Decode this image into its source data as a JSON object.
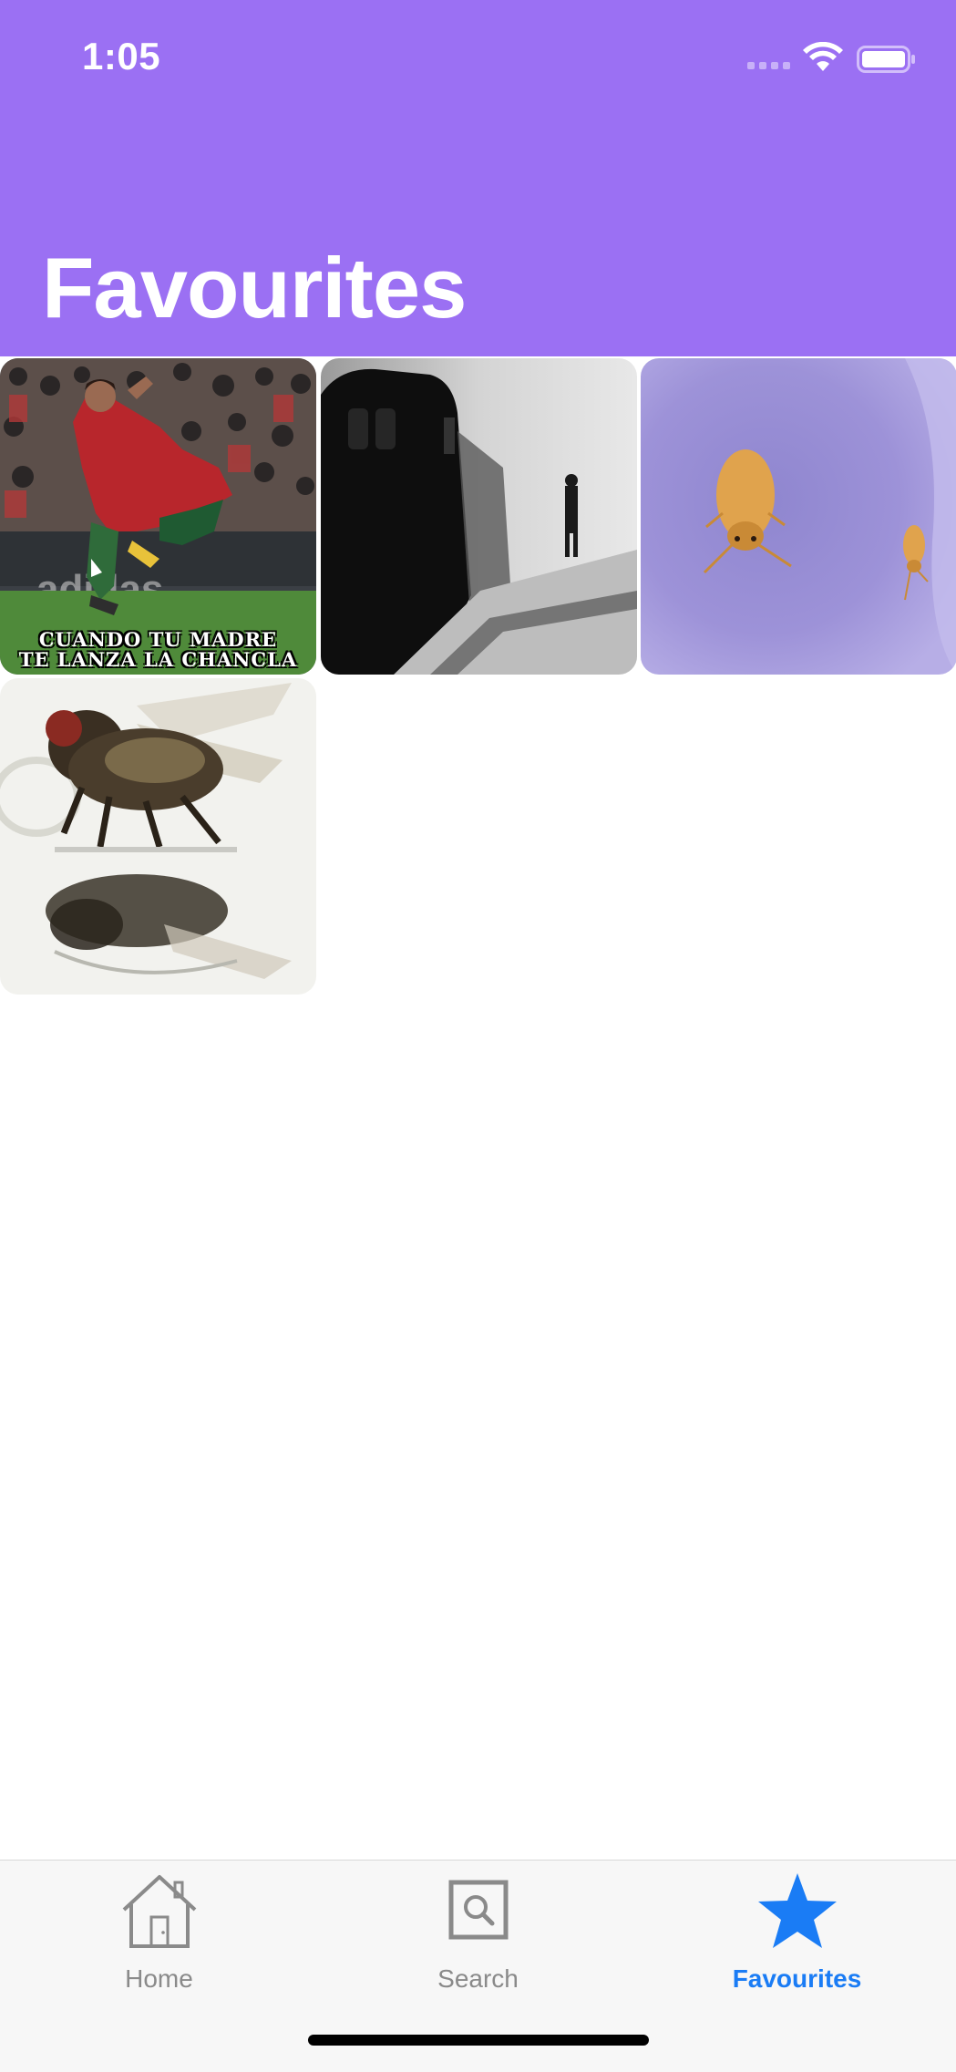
{
  "status_bar": {
    "time": "1:05"
  },
  "header": {
    "title": "Favourites",
    "background_color": "#9b70f3"
  },
  "favourites": [
    {
      "name": "football-meme",
      "caption_line_1": "CUANDO TU MADRE",
      "caption_line_2": "TE LANZA LA CHANCLA"
    },
    {
      "name": "foggy-train-platform"
    },
    {
      "name": "springtails-on-purple"
    },
    {
      "name": "fly-reflection"
    }
  ],
  "tabbar": {
    "items": [
      {
        "label": "Home",
        "icon": "home-icon",
        "selected": false
      },
      {
        "label": "Search",
        "icon": "search-icon",
        "selected": false
      },
      {
        "label": "Favourites",
        "icon": "star-icon",
        "selected": true
      }
    ],
    "selected_color": "#1a7cf5",
    "unselected_color": "#8a8a8a"
  }
}
